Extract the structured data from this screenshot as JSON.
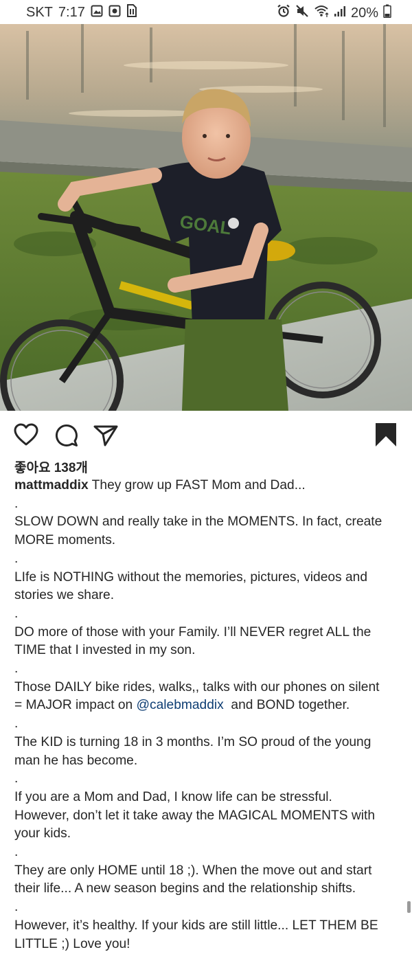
{
  "status_bar": {
    "carrier": "SKT",
    "time": "7:17",
    "battery": "20%",
    "left_icons": [
      "gallery-icon",
      "record-icon",
      "sim-icon"
    ],
    "right_icons": [
      "alarm-icon",
      "mute-icon",
      "wifi-icon",
      "signal-icon",
      "battery-icon"
    ]
  },
  "post": {
    "photo_alt": "Boy in GOAL t-shirt with bicycle",
    "shirt_text": "GOAL",
    "likes": "좋아요 138개",
    "username": "mattmaddix",
    "caption_first": " They grow up FAST Mom and Dad...",
    "caption_lines": [
      ".",
      "SLOW DOWN and really take in the MOMENTS. In fact, create",
      "MORE moments.",
      ".",
      "LIfe is NOTHING without the memories, pictures, videos and",
      "stories we share.",
      ".",
      "DO more of those with your Family. I’ll NEVER regret ALL the",
      "TIME that I invested in my son.",
      ".",
      "Those DAILY bike rides, walks,, talks with our phones on silent"
    ],
    "mention_line_prefix": "= MAJOR impact on ",
    "mention": "@calebmaddix",
    "mention_line_suffix": "  and BOND together.",
    "caption_lines_2": [
      ".",
      "The KID is turning 18 in 3 months. I’m SO proud of the young",
      "man he has become.",
      ".",
      "If you are a Mom and Dad, I know life can be stressful.",
      "However, don’t let it take away the MAGICAL MOMENTS with",
      "your kids.",
      ".",
      "They are only HOME until 18 ;). When the move out and start",
      "their life... A new season begins and the relationship shifts.",
      ".",
      "However, it’s healthy. If your kids are still little... LET THEM BE",
      "LITTLE ;) Love you!"
    ]
  },
  "actions": {
    "like_icon": "heart-icon",
    "comment_icon": "comment-icon",
    "share_icon": "share-icon",
    "save_icon": "bookmark-icon"
  },
  "colors": {
    "text": "#262626",
    "mention": "#0d3d73",
    "bookmark": "#262626"
  }
}
